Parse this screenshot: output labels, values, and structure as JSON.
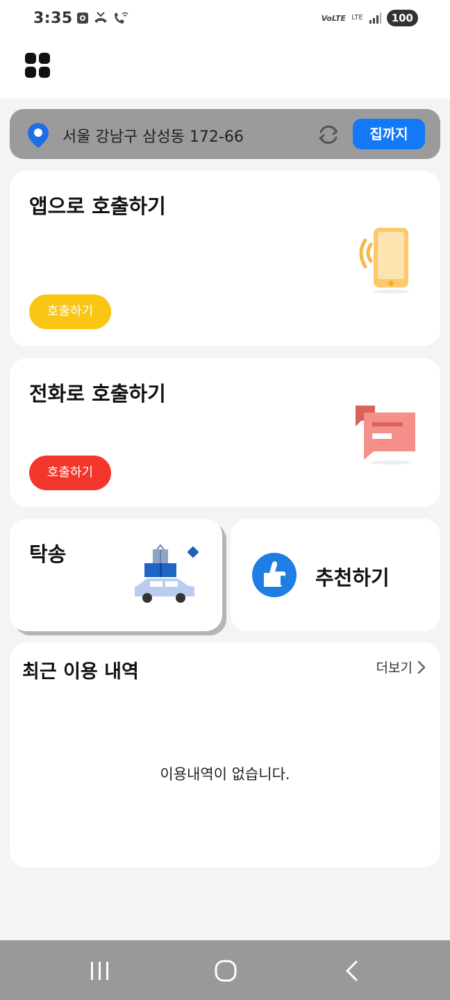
{
  "status_bar": {
    "time": "3:35",
    "network_label": "VoLTE",
    "lte_label": "LTE",
    "battery": "100"
  },
  "location": {
    "address": "서울 강남구 삼성동 172-66",
    "home_button": "집까지"
  },
  "cards": {
    "app_call": {
      "title": "앱으로 호출하기",
      "button": "호출하기",
      "button_color": "#fac613"
    },
    "phone_call": {
      "title": "전화로 호출하기",
      "button": "호출하기",
      "button_color": "#f2362c"
    },
    "valet": {
      "title": "탁송"
    },
    "recommend": {
      "label": "추천하기"
    }
  },
  "history": {
    "title": "최근 이용 내역",
    "more_label": "더보기",
    "empty_message": "이용내역이 없습니다."
  },
  "icons": [
    "menu-grid-icon",
    "location-pin-icon",
    "refresh-icon",
    "phone-call-icon",
    "chat-bubble-icon",
    "car-delivery-icon",
    "thumbs-up-icon",
    "chevron-right-icon",
    "nav-recent-icon",
    "nav-home-icon",
    "nav-back-icon"
  ],
  "colors": {
    "accent_blue": "#1479f6",
    "location_bar": "#9b9b9b",
    "nav_bar": "#999999"
  }
}
